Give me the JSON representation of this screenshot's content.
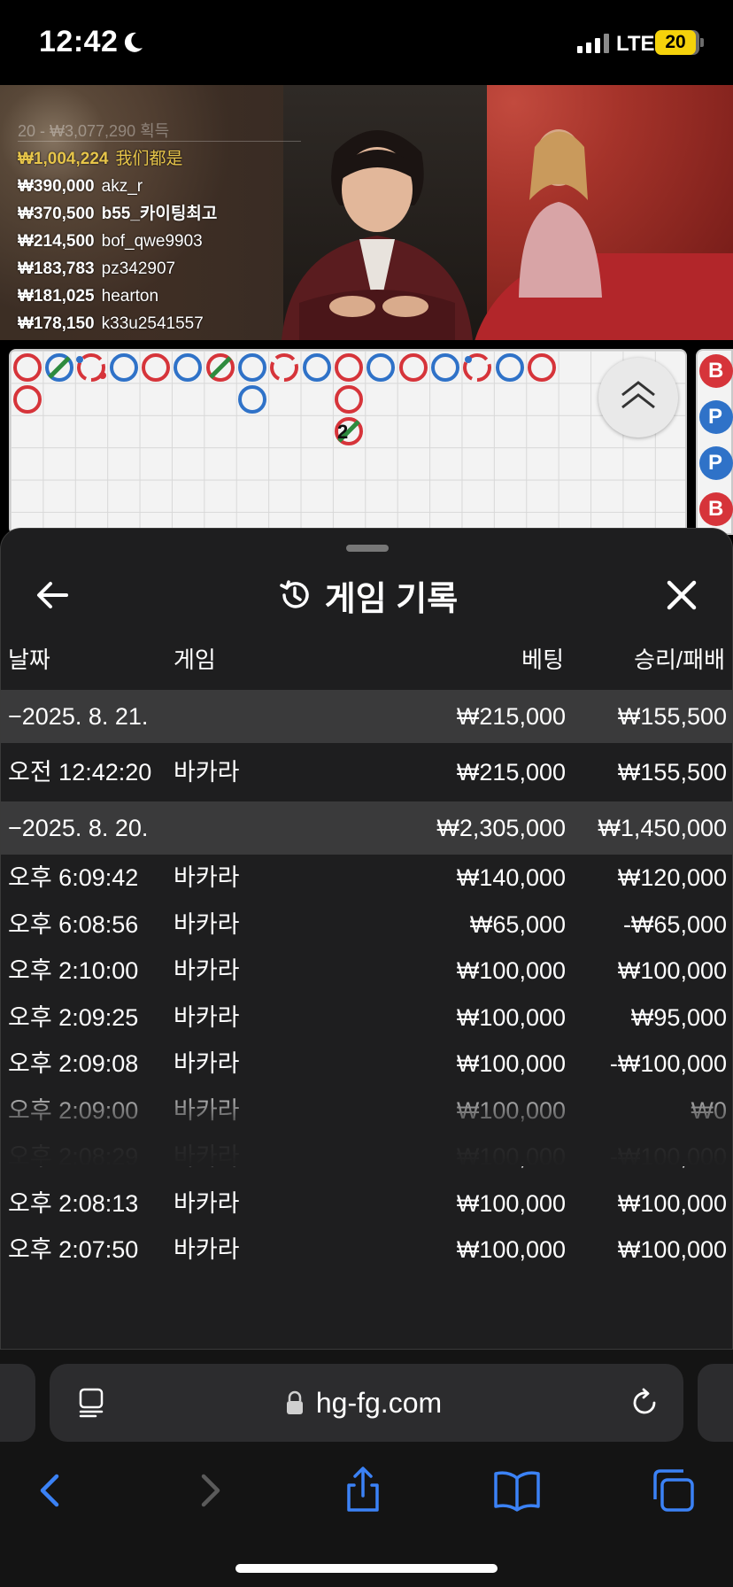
{
  "status_bar": {
    "time": "12:42",
    "network": "LTE",
    "battery": "20"
  },
  "live_feed": {
    "header": "20 - ₩3,077,290 획득",
    "entries": [
      {
        "amount": "₩1,004,224",
        "user": "我们都是"
      },
      {
        "amount": "₩390,000",
        "user": "akz_r"
      },
      {
        "amount": "₩370,500",
        "user": "b55_카이팅최고"
      },
      {
        "amount": "₩214,500",
        "user": "bof_qwe9903"
      },
      {
        "amount": "₩183,783",
        "user": "pz342907"
      },
      {
        "amount": "₩181,025",
        "user": "hearton"
      },
      {
        "amount": "₩178,150",
        "user": "k33u2541557"
      }
    ]
  },
  "scoreboard": {
    "tie_count_label": "2",
    "side_letters": [
      "B",
      "P",
      "P",
      "B"
    ],
    "colors": {
      "banker": "#d6343a",
      "player": "#2f72c8",
      "tie": "#2e8b3e"
    }
  },
  "sheet": {
    "title": "게임 기록",
    "columns": {
      "date": "날짜",
      "game": "게임",
      "bet": "베팅",
      "result": "승리/패배"
    },
    "rows": [
      {
        "group": true,
        "date": "−2025. 8. 21.",
        "game": "",
        "bet": "₩215,000",
        "result": "₩155,500"
      },
      {
        "group": false,
        "date": "오전 12:42:20",
        "game": "바카라",
        "bet": "₩215,000",
        "result": "₩155,500"
      },
      {
        "group": true,
        "date": "−2025. 8. 20.",
        "game": "",
        "bet": "₩2,305,000",
        "result": "₩1,450,000"
      },
      {
        "group": false,
        "date": "오후 6:09:42",
        "game": "바카라",
        "bet": "₩140,000",
        "result": "₩120,000"
      },
      {
        "group": false,
        "date": "오후 6:08:56",
        "game": "바카라",
        "bet": "₩65,000",
        "result": "-₩65,000"
      },
      {
        "group": false,
        "date": "오후 2:10:00",
        "game": "바카라",
        "bet": "₩100,000",
        "result": "₩100,000"
      },
      {
        "group": false,
        "date": "오후 2:09:25",
        "game": "바카라",
        "bet": "₩100,000",
        "result": "₩95,000"
      },
      {
        "group": false,
        "date": "오후 2:09:08",
        "game": "바카라",
        "bet": "₩100,000",
        "result": "-₩100,000"
      },
      {
        "group": false,
        "date": "오후 2:09:00",
        "game": "바카라",
        "bet": "₩100,000",
        "result": "₩0"
      },
      {
        "group": false,
        "date": "오후 2:08:29",
        "game": "바카라",
        "bet": "₩100,000",
        "result": "-₩100,000"
      },
      {
        "group": false,
        "date": "오후 2:08:13",
        "game": "바카라",
        "bet": "₩100,000",
        "result": "₩100,000"
      },
      {
        "group": false,
        "date": "오후 2:07:50",
        "game": "바카라",
        "bet": "₩100,000",
        "result": "₩100,000"
      }
    ]
  },
  "browser": {
    "url": "hg-fg.com"
  },
  "icons": {
    "back": "arrow-left-icon",
    "close": "close-icon",
    "history": "history-icon",
    "nav_back": "chevron-left-icon",
    "nav_forward": "chevron-right-icon",
    "share": "share-icon",
    "bookmarks": "book-icon",
    "tabs": "tabs-icon",
    "lock": "lock-icon",
    "reader": "reader-icon",
    "reload": "reload-icon"
  }
}
